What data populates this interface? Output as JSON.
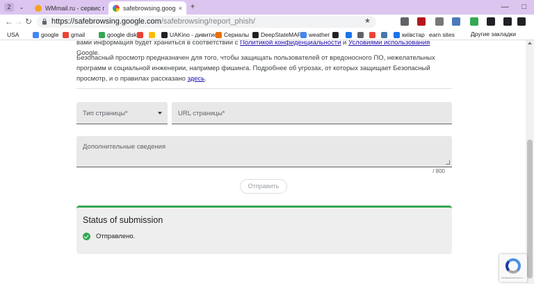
{
  "browser": {
    "tab_count": "2",
    "tabs": [
      {
        "title": "WMmail.ru - сервис почто",
        "favicon_color": "#f4a321"
      },
      {
        "title": "safebrowsing.google.co",
        "favicon_color": "#4285f4"
      }
    ],
    "url": {
      "host": "https://safebrowsing.google.com",
      "path": "/safebrowsing/report_phish/"
    },
    "icons": {
      "back": "←",
      "forward": "→",
      "reload": "↻",
      "new_tab": "+",
      "close": "×",
      "minimize": "—",
      "maximize": "□",
      "star": "★",
      "tab_list": "⌄"
    },
    "extensions": [
      {
        "name": "globe-icon",
        "color": "#5f6368"
      },
      {
        "name": "ublock-icon",
        "color": "#b5161b"
      },
      {
        "name": "screenshot-icon",
        "color": "#777777"
      },
      {
        "name": "window-icon",
        "color": "#4a7ab8"
      },
      {
        "name": "download-icon",
        "color": "#34a853"
      },
      {
        "name": "extension-arrow-icon",
        "color": "#202124"
      },
      {
        "name": "reading-list-icon",
        "color": "#202124"
      },
      {
        "name": "download-manager-icon",
        "color": "#202124"
      },
      {
        "name": "profile-icon",
        "color": "#202124"
      }
    ],
    "bookmarks": [
      {
        "label": "USA",
        "color": ""
      },
      {
        "label": "google",
        "color": "#4285f4"
      },
      {
        "label": "gmail",
        "color": "#ea4335"
      },
      {
        "label": "google disk",
        "color": "#34a853"
      },
      {
        "label": "",
        "color": "#ea4335"
      },
      {
        "label": "",
        "color": "#fbbc04"
      },
      {
        "label": "UAKino - дивитис",
        "color": "#202124"
      },
      {
        "label": "Сериалы",
        "color": "#e8710a"
      },
      {
        "label": "DeepStateMAP",
        "color": "#202124"
      },
      {
        "label": "weather",
        "color": "#4285f4"
      },
      {
        "label": "",
        "color": "#202124"
      },
      {
        "label": "",
        "color": "#1a73e8"
      },
      {
        "label": "",
        "color": "#5f6368"
      },
      {
        "label": "",
        "color": "#ea4335"
      },
      {
        "label": "",
        "color": "#4a76a8"
      },
      {
        "label": "київстар",
        "color": "#1a73e8"
      },
      {
        "label": "earn sites",
        "color": ""
      }
    ],
    "other_bookmarks": "Другие закладки"
  },
  "page": {
    "p1_text": "вами информация будет храниться в соответствии с ",
    "p1_link1": "Политикой конфиденциальности",
    "p1_and": " и ",
    "p1_link2": "Условиями использования",
    "p1_end": " Google.",
    "p2_text": "Безопасный просмотр предназначен для того, чтобы защищать пользователей от вредоносного ПО, нежелательных программ и социальной инженерии, например фишинга. Подробнее об угрозах, от которых защищает Безопасный просмотр, и о правилах рассказано ",
    "p2_link": "здесь",
    "p2_end": ".",
    "form": {
      "page_type_label": "Тип страницы*",
      "url_label": "URL страницы*",
      "details_label": "Дополнительные сведения",
      "char_counter": "/ 800",
      "submit_label": "Отправить"
    },
    "status": {
      "title": "Status of submission",
      "message": "Отправлено."
    }
  },
  "recaptcha": {
    "legal": "Конфиденциальность - Условия использования"
  },
  "colors": {
    "accent_green": "#34a853",
    "link": "#1a0dab",
    "tabstrip": "#dcc6f0"
  }
}
